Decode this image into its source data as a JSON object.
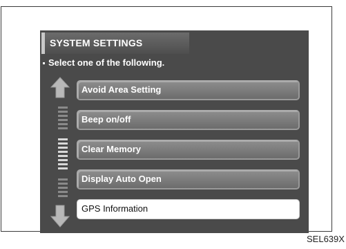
{
  "screen": {
    "title": "SYSTEM SETTINGS",
    "instruction": "Select one of the following.",
    "menu_items": [
      {
        "label": "Avoid Area Setting",
        "selected": false
      },
      {
        "label": "Beep on/off",
        "selected": false
      },
      {
        "label": "Clear Memory",
        "selected": false
      },
      {
        "label": "Display Auto Open",
        "selected": false
      },
      {
        "label": "GPS Information",
        "selected": true
      }
    ]
  },
  "figure_code": "SEL639X",
  "colors": {
    "screen_background": "#4a4a4a",
    "button": "#7d7d7d",
    "selected_button": "#ffffff"
  },
  "icons": [
    "scroll-up-arrow-icon",
    "scroll-down-arrow-icon"
  ]
}
